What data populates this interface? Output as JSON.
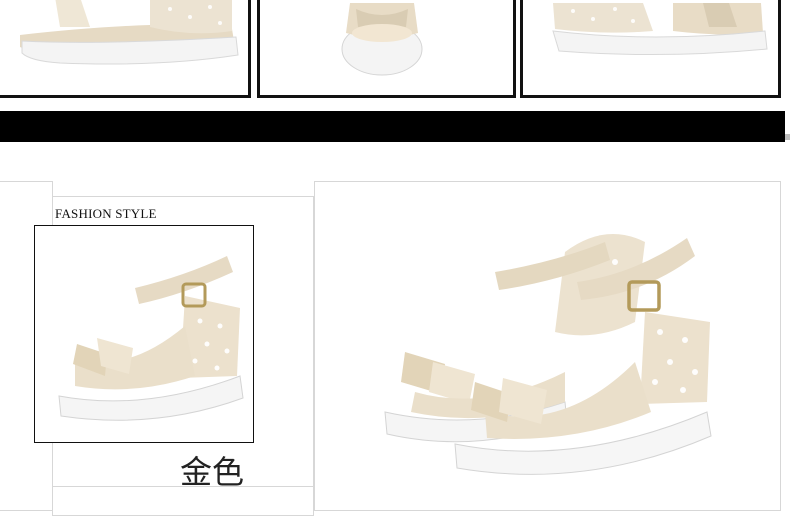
{
  "section_label": "FASHION STYLE",
  "color_label": "金色",
  "colors": {
    "frame": "#111111",
    "band": "#000000",
    "shoe_gold": "#e8dcc4",
    "shoe_sole": "#f3f3f3",
    "accent_line": "#cfcfcf"
  }
}
